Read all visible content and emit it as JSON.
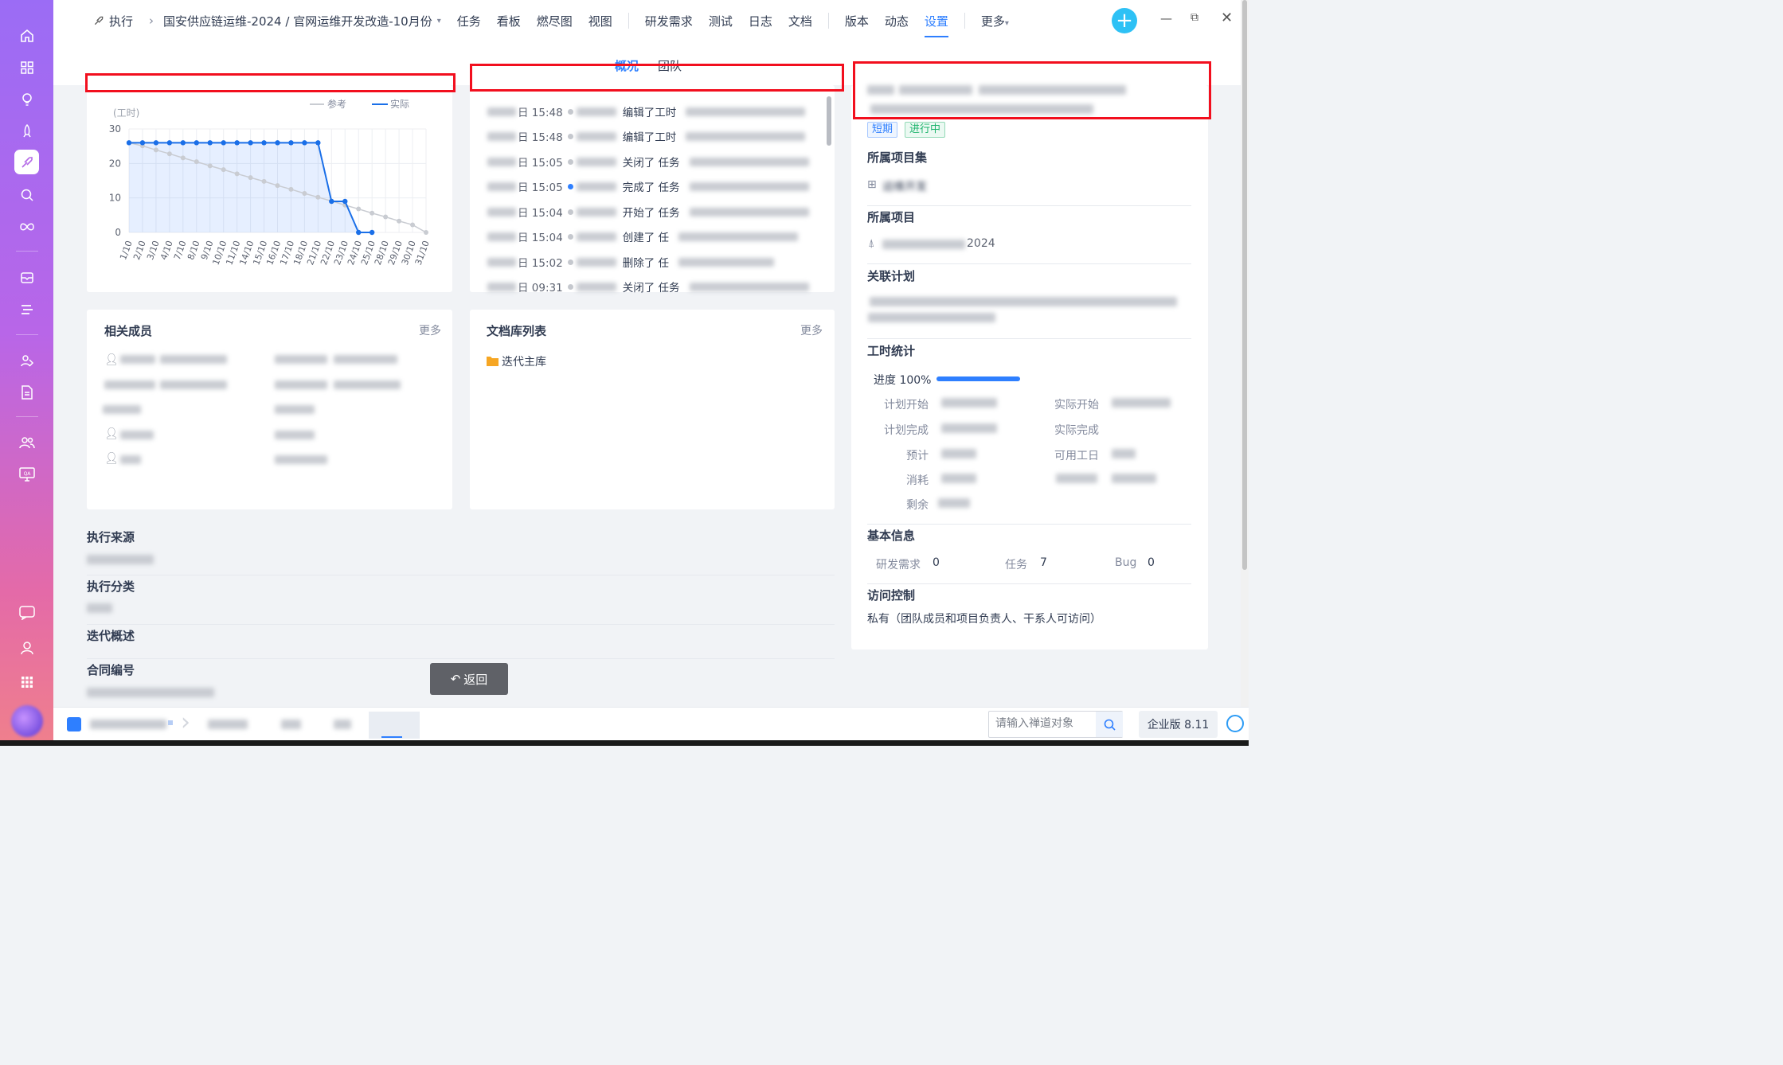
{
  "topbar": {
    "breadcrumb_root": "执行",
    "breadcrumb_path": "国安供应链运维-2024 / 官网运维开发改造-10月份",
    "menu": [
      "任务",
      "看板",
      "燃尽图",
      "视图",
      "研发需求",
      "测试",
      "日志",
      "文档",
      "版本",
      "动态",
      "设置",
      "更多"
    ],
    "active_menu": "设置"
  },
  "subtabs": {
    "overview": "概况",
    "team": "团队",
    "active": "概况"
  },
  "burndown": {
    "unit_label": "(工时)",
    "legend_ref": "参考",
    "legend_actual": "实际"
  },
  "chart_data": {
    "type": "line",
    "categories": [
      "1/10",
      "2/10",
      "3/10",
      "4/10",
      "7/10",
      "8/10",
      "9/10",
      "10/10",
      "11/10",
      "14/10",
      "15/10",
      "16/10",
      "17/10",
      "18/10",
      "21/10",
      "22/10",
      "23/10",
      "24/10",
      "25/10",
      "28/10",
      "29/10",
      "30/10",
      "31/10"
    ],
    "series": [
      {
        "name": "参考",
        "values": [
          26,
          25.1,
          23.9,
          22.8,
          21.6,
          20.5,
          19.3,
          18.2,
          17.0,
          15.9,
          14.8,
          13.6,
          12.5,
          11.3,
          10.2,
          9.1,
          7.9,
          6.8,
          5.6,
          4.5,
          3.3,
          2.2,
          0
        ]
      },
      {
        "name": "实际",
        "values": [
          26,
          26,
          26,
          26,
          26,
          26,
          26,
          26,
          26,
          26,
          26,
          26,
          26,
          26,
          26,
          9,
          9,
          0,
          0
        ]
      }
    ],
    "yticks": [
      0,
      10,
      20,
      30
    ],
    "ylim": [
      0,
      30
    ],
    "grid": true,
    "legend": "top-right"
  },
  "activity": {
    "rows": [
      {
        "time": "日 15:48",
        "action": "编辑了工时"
      },
      {
        "time": "日 15:48",
        "action": "编辑了工时"
      },
      {
        "time": "日 15:05",
        "action": "关闭了 任务"
      },
      {
        "time": "日 15:05",
        "action": "完成了 任务"
      },
      {
        "time": "日 15:04",
        "action": "开始了 任务"
      },
      {
        "time": "日 15:04",
        "action": "创建了 任"
      },
      {
        "time": "日 15:02",
        "action": "删除了 任"
      },
      {
        "time": "日 09:31",
        "action": "关闭了 任务"
      }
    ]
  },
  "members": {
    "title": "相关成员",
    "more": "更多"
  },
  "doclib": {
    "title": "文档库列表",
    "more": "更多",
    "items": [
      "迭代主库"
    ]
  },
  "fields": {
    "source_label": "执行来源",
    "category_label": "执行分类",
    "overview_label": "迭代概述",
    "contract_label": "合同编号"
  },
  "back_button": "返回",
  "details": {
    "badge_short": "短期",
    "badge_status": "进行中",
    "program_label": "所属项目集",
    "program_value": "运维开发",
    "project_label": "所属项目",
    "project_value": "2024",
    "plan_label": "关联计划",
    "hours_label": "工时统计",
    "progress_text": "进度 100%",
    "progress_value": 1.0,
    "plan_start_label": "计划开始",
    "plan_end_label": "计划完成",
    "estimate_label": "预计",
    "consumed_label": "消耗",
    "remain_label": "剩余",
    "real_start_label": "实际开始",
    "real_end_label": "实际完成",
    "workdays_label": "可用工日",
    "basic_label": "基本信息",
    "req_label": "研发需求",
    "req_count": "0",
    "task_label": "任务",
    "task_count": "7",
    "bug_label": "Bug",
    "bug_count": "0",
    "acl_label": "访问控制",
    "acl_value": "私有（团队成员和项目负责人、干系人可访问）"
  },
  "bottombar": {
    "search_placeholder": "请输入禅道对象",
    "edition": "企业版 8.11"
  },
  "colors": {
    "accent": "#2e7fff",
    "actual_line": "#1a6fe8",
    "reference_line": "#c9ccd2",
    "red_box": "#f20f1e"
  }
}
